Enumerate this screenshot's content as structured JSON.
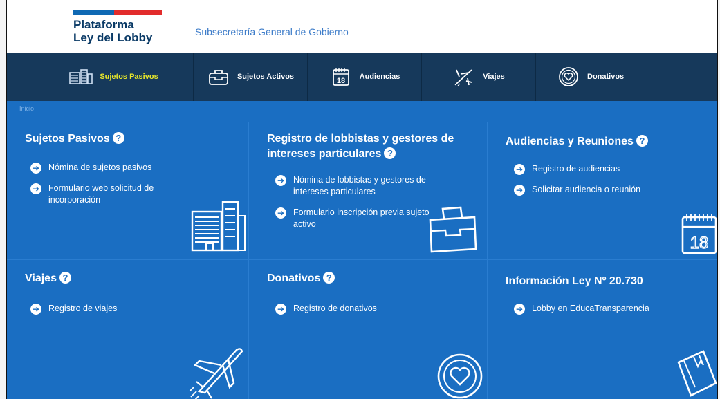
{
  "header": {
    "brand_line1": "Plataforma",
    "brand_line2": "Ley del Lobby",
    "subtitle": "Subsecretaría General de Gobierno",
    "flag_colors": [
      "#0f69b4",
      "#e22c2c"
    ]
  },
  "nav": {
    "items": [
      {
        "label": "Sujetos Pasivos",
        "icon": "buildings-icon",
        "active": true
      },
      {
        "label": "Sujetos Activos",
        "icon": "briefcase-icon",
        "active": false
      },
      {
        "label": "Audiencias",
        "icon": "calendar-icon",
        "active": false
      },
      {
        "label": "Viajes",
        "icon": "airplane-icon",
        "active": false
      },
      {
        "label": "Donativos",
        "icon": "heart-icon",
        "active": false
      }
    ]
  },
  "breadcrumb": "Inicio",
  "cards": {
    "sujetos_pasivos": {
      "title": "Sujetos Pasivos",
      "links": [
        "Nómina de sujetos pasivos",
        "Formulario web solicitud de incorporación"
      ],
      "icon": "buildings-icon"
    },
    "registro_lobbistas": {
      "title_line1": "Registro de lobbistas y gestores de",
      "title_line2": "intereses particulares",
      "links": [
        "Nómina de lobbistas y gestores de intereses particulares",
        "Formulario inscripción previa sujeto activo"
      ],
      "icon": "briefcase-icon"
    },
    "audiencias": {
      "title": "Audiencias y Reuniones",
      "links": [
        "Registro de audiencias",
        "Solicitar audiencia o reunión"
      ],
      "icon": "calendar-icon",
      "calendar_day": "18"
    },
    "viajes": {
      "title": "Viajes",
      "links": [
        "Registro de viajes"
      ],
      "icon": "airplane-icon"
    },
    "donativos": {
      "title": "Donativos",
      "links": [
        "Registro de donativos"
      ],
      "icon": "heart-icon"
    },
    "informacion": {
      "title": "Información Ley Nº 20.730",
      "links": [
        "Lobby en EducaTransparencia"
      ],
      "icon": "book-icon"
    }
  },
  "colors": {
    "nav_bg": "#16395b",
    "main_bg": "#1a6ec2",
    "active_nav": "#e9e82a",
    "brand_text": "#0a3a66",
    "subtitle_text": "#3d7cc9"
  }
}
